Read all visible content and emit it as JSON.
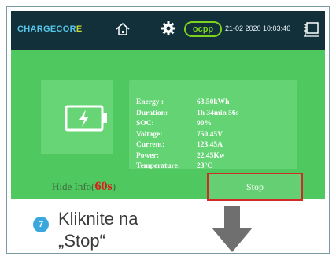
{
  "header": {
    "logo_text_1": "CHARGECOR",
    "logo_text_2": "E",
    "protocol_badge": "ocpp",
    "datetime": "21-02 2020  10:03:46"
  },
  "charging_info": [
    {
      "label": "Energy :",
      "value": "63.50kWh"
    },
    {
      "label": "Duration:",
      "value": "1h 34min 56s"
    },
    {
      "label": "SOC:",
      "value": "90%"
    },
    {
      "label": "Voltage:",
      "value": "750.45V"
    },
    {
      "label": "Current:",
      "value": "123.45A"
    },
    {
      "label": "Power:",
      "value": "22.45Kw"
    },
    {
      "label": "Temperature:",
      "value": "23°C"
    }
  ],
  "footer": {
    "hide_info_prefix": "Hide Info(",
    "hide_info_timer": "60s",
    "hide_info_suffix": ")",
    "stop_label": "Stop"
  },
  "instruction": {
    "step_number": "7",
    "line1": "Kliknite na",
    "line2": "„Stop“"
  },
  "colors": {
    "screen_green": "#4fc95f",
    "topbar": "#12303a",
    "highlight_red": "#d02b2b",
    "step_blue": "#3aa8dd"
  }
}
